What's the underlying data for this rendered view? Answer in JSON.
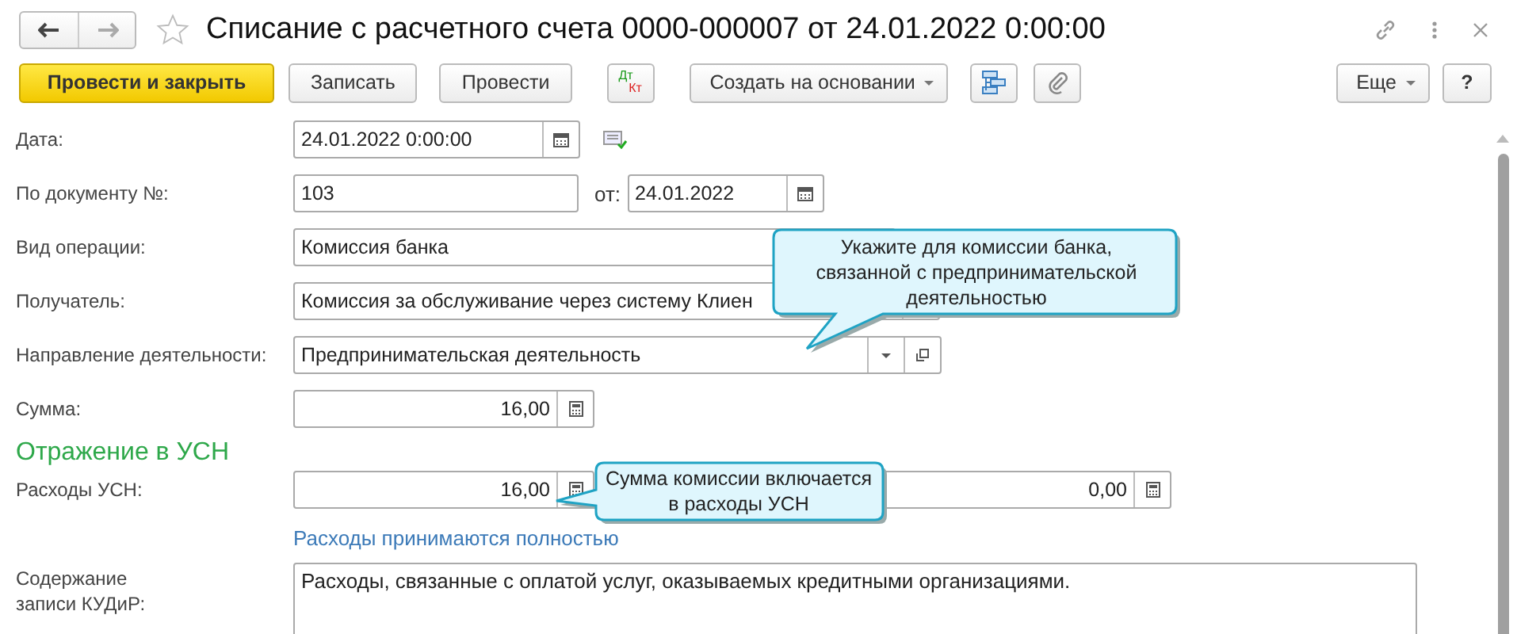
{
  "window": {
    "title": "Списание с расчетного счета 0000-000007 от 24.01.2022 0:00:00",
    "favorite": false
  },
  "toolbar": [
    {
      "kind": "primary",
      "label": "Провести и закрыть"
    },
    {
      "kind": "button",
      "label": "Записать"
    },
    {
      "kind": "button",
      "label": "Провести"
    },
    {
      "kind": "dtkt",
      "label": "Дт",
      "label2": "Кт"
    },
    {
      "kind": "dropdown",
      "label": "Создать на основании"
    },
    {
      "kind": "structure"
    },
    {
      "kind": "attach"
    }
  ],
  "toolbar_right": [
    {
      "kind": "dropdown",
      "label": "Еще"
    },
    {
      "kind": "button",
      "label": "?"
    }
  ],
  "fields": [
    {
      "kind": "date",
      "label": "Дата:",
      "value": "24.01.2022  0:00:00"
    },
    {
      "kind": "docnum",
      "label": "По документу №:",
      "value": "103",
      "label2": "от:",
      "value2": "24.01.2022"
    },
    {
      "kind": "text",
      "label": "Вид операции:",
      "value": "Комиссия банка"
    },
    {
      "kind": "select",
      "label": "Получатель:",
      "value": "Комиссия за обслуживание через систему Клиен"
    },
    {
      "kind": "select_open",
      "label": "Направление деятельности:",
      "value": "Предпринимательская деятельность"
    },
    {
      "kind": "number",
      "label": "Сумма:",
      "value": "16,00"
    }
  ],
  "usn": {
    "heading": "Отражение в УСН",
    "label": "Расходы УСН:",
    "value": "16,00",
    "value2": "0,00",
    "link": "Расходы принимаются полностью",
    "memo_label": "Содержание записи КУДиР:",
    "memo": "Расходы, связанные с оплатой услуг, оказываемых кредитными организациями."
  },
  "callouts": [
    {
      "text": "Укажите для комиссии банка, связанной с предпринимательской деятельностью"
    },
    {
      "text": "Сумма комиссии включается в расходы УСН"
    }
  ]
}
